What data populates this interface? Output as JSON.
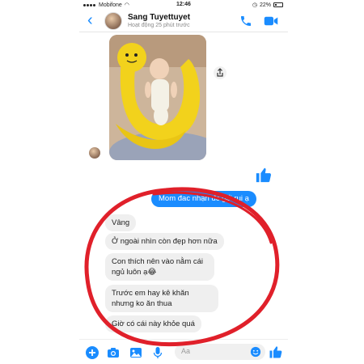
{
  "status_bar": {
    "carrier": "Mobifone",
    "time": "12:46",
    "battery": "22%"
  },
  "header": {
    "contact_name": "Sang Tuyettuyet",
    "contact_status": "Hoạt động 25 phút trước"
  },
  "messages": {
    "outgoing": [
      {
        "text": "Mom đac nhận đc gối rui ạ"
      }
    ],
    "incoming": [
      {
        "text": "Vâng"
      },
      {
        "text": "Ở ngoài nhìn còn đẹp hơn nữa"
      },
      {
        "text": "Con thích nên vào nằm cái ngủ luôn ạ😂"
      },
      {
        "text": "Trước em hay kê khăn nhưng ko ăn thua"
      },
      {
        "text": "Giờ có cái này khỏe quá"
      }
    ]
  },
  "composer": {
    "placeholder": "Aa"
  },
  "colors": {
    "accent": "#1a8cff",
    "annotation": "#e0202a"
  }
}
